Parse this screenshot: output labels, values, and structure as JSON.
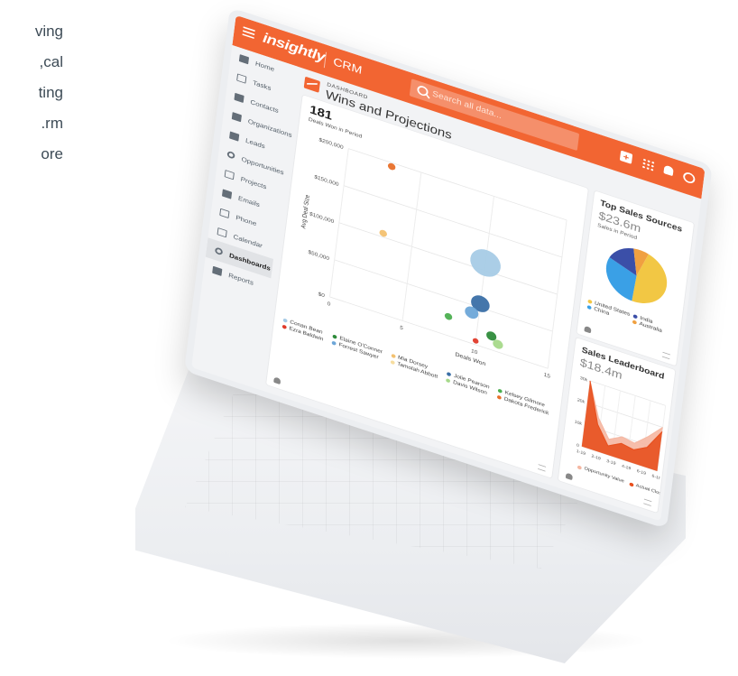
{
  "left_text": {
    "line1": "ving",
    "line2": "cal,",
    "line3": "ting",
    "line4": "rm.",
    "line5": "ore"
  },
  "app": {
    "logo": "insightly",
    "module": "CRM",
    "search_placeholder": "Search all data...",
    "accent_color": "#f26532",
    "top_icons": [
      "plus-icon",
      "apps-grid-icon",
      "bell-icon",
      "user-icon"
    ]
  },
  "sidebar": {
    "items": [
      {
        "label": "Home",
        "icon": "home-icon"
      },
      {
        "label": "Tasks",
        "icon": "tasks-icon"
      },
      {
        "label": "Contacts",
        "icon": "contacts-icon"
      },
      {
        "label": "Organizations",
        "icon": "organizations-icon"
      },
      {
        "label": "Leads",
        "icon": "leads-icon"
      },
      {
        "label": "Opportunities",
        "icon": "opportunities-icon"
      },
      {
        "label": "Projects",
        "icon": "projects-icon"
      },
      {
        "label": "Emails",
        "icon": "emails-icon"
      },
      {
        "label": "Phone",
        "icon": "phone-icon"
      },
      {
        "label": "Calendar",
        "icon": "calendar-icon"
      },
      {
        "label": "Dashboards",
        "icon": "dashboards-icon",
        "active": true
      },
      {
        "label": "Reports",
        "icon": "reports-icon"
      }
    ]
  },
  "dashboard": {
    "kicker": "DASHBOARD",
    "title": "Wins and Projections"
  },
  "wins_card": {
    "total": "181",
    "subtitle": "Deals Won in Period"
  },
  "sources_card": {
    "title": "Top Sales Sources",
    "amount": "$23.6m",
    "subtitle": "Sales in Period",
    "legend": [
      {
        "label": "United States",
        "color": "#f2c744"
      },
      {
        "label": "India",
        "color": "#3b4fa8"
      },
      {
        "label": "China",
        "color": "#3aa0e6"
      },
      {
        "label": "Australia",
        "color": "#f0a040"
      }
    ]
  },
  "leaderboard_card": {
    "title": "Sales Leaderboard",
    "amount": "$18.4m",
    "legend": [
      {
        "label": "Opportunity Value",
        "color": "#f5b7a2"
      },
      {
        "label": "Actual Close",
        "color": "#e8501e"
      }
    ]
  },
  "chart_data": [
    {
      "type": "scatter",
      "title": "",
      "xlabel": "Deals Won",
      "ylabel": "Avg Deal Size",
      "xlim": [
        0,
        15
      ],
      "ylim": [
        0,
        200000
      ],
      "x_ticks": [
        "0",
        "5",
        "10",
        "15"
      ],
      "y_ticks": [
        "$0",
        "$50,000",
        "$100,000",
        "$150,000",
        "$200,000"
      ],
      "series": [
        {
          "name": "Conan Bean",
          "color": "#a6cbe6",
          "points": [
            {
              "x": 10,
              "y": 110000,
              "size": 18
            }
          ]
        },
        {
          "name": "Elaine O'Conner",
          "color": "#2e8b3a",
          "points": [
            {
              "x": 11,
              "y": 18000,
              "size": 6
            }
          ]
        },
        {
          "name": "Mia Dorsey",
          "color": "#f3c170",
          "points": [
            {
              "x": 3,
              "y": 105000,
              "size": 4.5
            }
          ]
        },
        {
          "name": "Jolie Pearson",
          "color": "#3a6fa6",
          "points": [
            {
              "x": 10,
              "y": 55000,
              "size": 11
            }
          ]
        },
        {
          "name": "Kelsey Gilmore",
          "color": "#4caf50",
          "points": [
            {
              "x": 8,
              "y": 25000,
              "size": 4.5
            }
          ]
        },
        {
          "name": "Ezra Baldwin",
          "color": "#e03a2a",
          "points": [
            {
              "x": 10,
              "y": 5000,
              "size": 3.5
            }
          ]
        },
        {
          "name": "Forrest Sawyer",
          "color": "#6da6d8",
          "points": [
            {
              "x": 9.5,
              "y": 40000,
              "size": 8
            }
          ]
        },
        {
          "name": "Tamolah Abbott",
          "color": "#f7dea0",
          "points": []
        },
        {
          "name": "Davis Wilson",
          "color": "#a6d98a",
          "points": [
            {
              "x": 11.5,
              "y": 10000,
              "size": 6
            }
          ]
        },
        {
          "name": "Dakota Frederick",
          "color": "#e8702a",
          "points": [
            {
              "x": 3,
              "y": 195000,
              "size": 4.5
            }
          ]
        }
      ]
    },
    {
      "type": "pie",
      "title": "Top Sales Sources",
      "slices": [
        {
          "label": "United States",
          "value": 0.46,
          "color": "#f2c744"
        },
        {
          "label": "China",
          "value": 0.3,
          "color": "#3aa0e6"
        },
        {
          "label": "India",
          "value": 0.16,
          "color": "#3b4fa8"
        },
        {
          "label": "Australia",
          "value": 0.08,
          "color": "#f0a040"
        }
      ]
    },
    {
      "type": "area",
      "title": "Sales Leaderboard",
      "categories": [
        "1-19",
        "2-19",
        "3-19",
        "4-19",
        "5-19",
        "6-19"
      ],
      "x_ticks": [
        "1-19",
        "2-19",
        "3-19",
        "4-19",
        "6-19",
        "6-19"
      ],
      "y_ticks": [
        "0",
        "10k",
        "20k",
        "30k"
      ],
      "ylim": [
        0,
        30000
      ],
      "series": [
        {
          "name": "Opportunity Value",
          "color": "#f5b7a2",
          "values": [
            30000,
            15000,
            7000,
            10000,
            9000,
            14000,
            20000
          ]
        },
        {
          "name": "Actual Close",
          "color": "#e8501e",
          "values": [
            30000,
            12000,
            4000,
            7000,
            6000,
            9000,
            18000
          ]
        }
      ]
    }
  ]
}
